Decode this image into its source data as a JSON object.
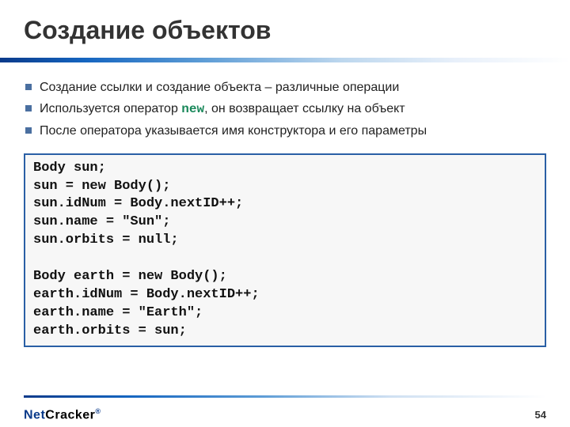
{
  "title": "Создание объектов",
  "bullets": [
    {
      "pre": "Создание ссылки и создание объекта – различные операции"
    },
    {
      "pre": "Используется оператор ",
      "kw": "new",
      "post": ", он возвращает ссылку на объект"
    },
    {
      "pre": "После оператора указывается имя конструктора и его параметры"
    }
  ],
  "code": "Body sun;\nsun = new Body();\nsun.idNum = Body.nextID++;\nsun.name = \"Sun\";\nsun.orbits = null;\n\nBody earth = new Body();\nearth.idNum = Body.nextID++;\nearth.name = \"Earth\";\nearth.orbits = sun;",
  "logo": {
    "part1": "Net",
    "part2": "Cracker",
    "reg": "®"
  },
  "page_number": "54"
}
